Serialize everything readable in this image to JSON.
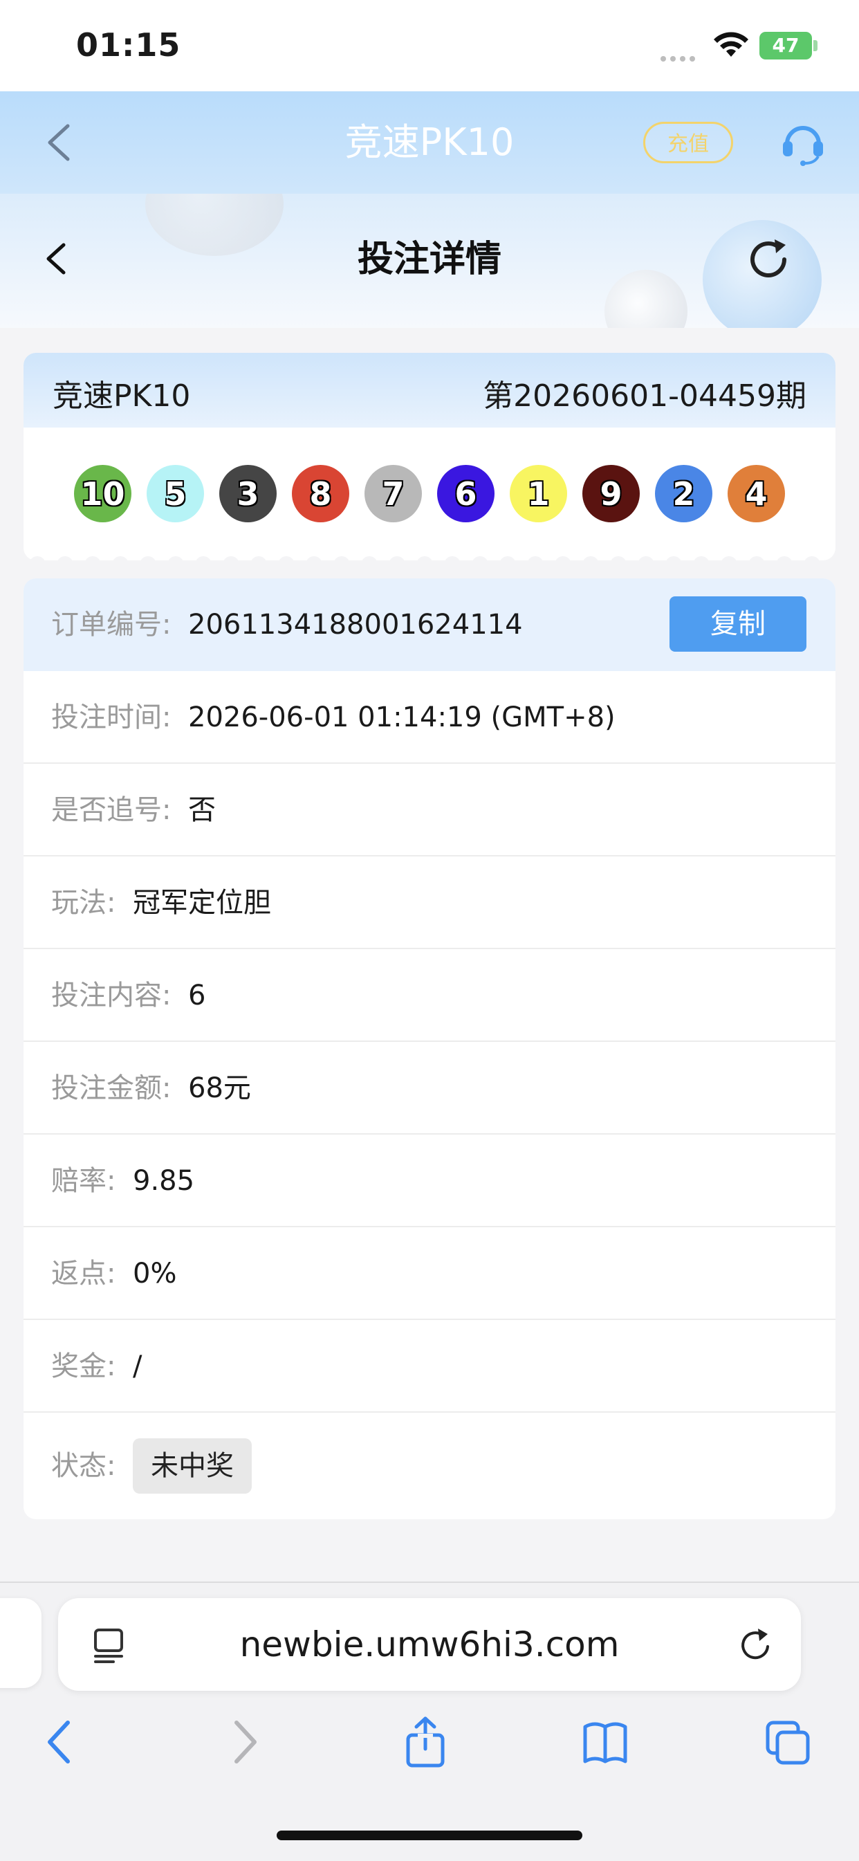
{
  "status_bar": {
    "time": "01:15",
    "battery": "47"
  },
  "app_header": {
    "title": "竞速PK10",
    "recharge_label": "充值"
  },
  "sub_header": {
    "title": "投注详情"
  },
  "draw": {
    "game_name": "竞速PK10",
    "period": "第20260601-04459期",
    "balls": [
      {
        "number": "10",
        "color": "#69b74a"
      },
      {
        "number": "5",
        "color": "#b6f3f6"
      },
      {
        "number": "3",
        "color": "#454545"
      },
      {
        "number": "8",
        "color": "#d94533"
      },
      {
        "number": "7",
        "color": "#b8b8b8"
      },
      {
        "number": "6",
        "color": "#3a17e0"
      },
      {
        "number": "1",
        "color": "#f8f561"
      },
      {
        "number": "9",
        "color": "#5a1310"
      },
      {
        "number": "2",
        "color": "#4a86e6"
      },
      {
        "number": "4",
        "color": "#e07f3a"
      }
    ]
  },
  "details": {
    "order_no": {
      "label": "订单编号:",
      "value": "2061134188001624114"
    },
    "copy_label": "复制",
    "bet_time": {
      "label": "投注时间:",
      "value": "2026-06-01 01:14:19 (GMT+8)"
    },
    "chase": {
      "label": "是否追号:",
      "value": "否"
    },
    "play": {
      "label": "玩法:",
      "value": "冠军定位胆"
    },
    "content": {
      "label": "投注内容:",
      "value": "6"
    },
    "amount": {
      "label": "投注金额:",
      "value": "68元"
    },
    "odds": {
      "label": "赔率:",
      "value": "9.85"
    },
    "rebate": {
      "label": "返点:",
      "value": "0%"
    },
    "prize": {
      "label": "奖金:",
      "value": "/"
    },
    "status": {
      "label": "状态:",
      "value": "未中奖"
    }
  },
  "browser": {
    "url": "newbie.umw6hi3.com"
  },
  "icons": {
    "back": "chevron-left-icon",
    "headset": "headset-icon",
    "refresh": "refresh-icon",
    "reader": "reader-mode-icon",
    "reload": "reload-icon",
    "share": "share-icon",
    "bookmarks": "book-icon",
    "tabs": "tabs-icon"
  }
}
